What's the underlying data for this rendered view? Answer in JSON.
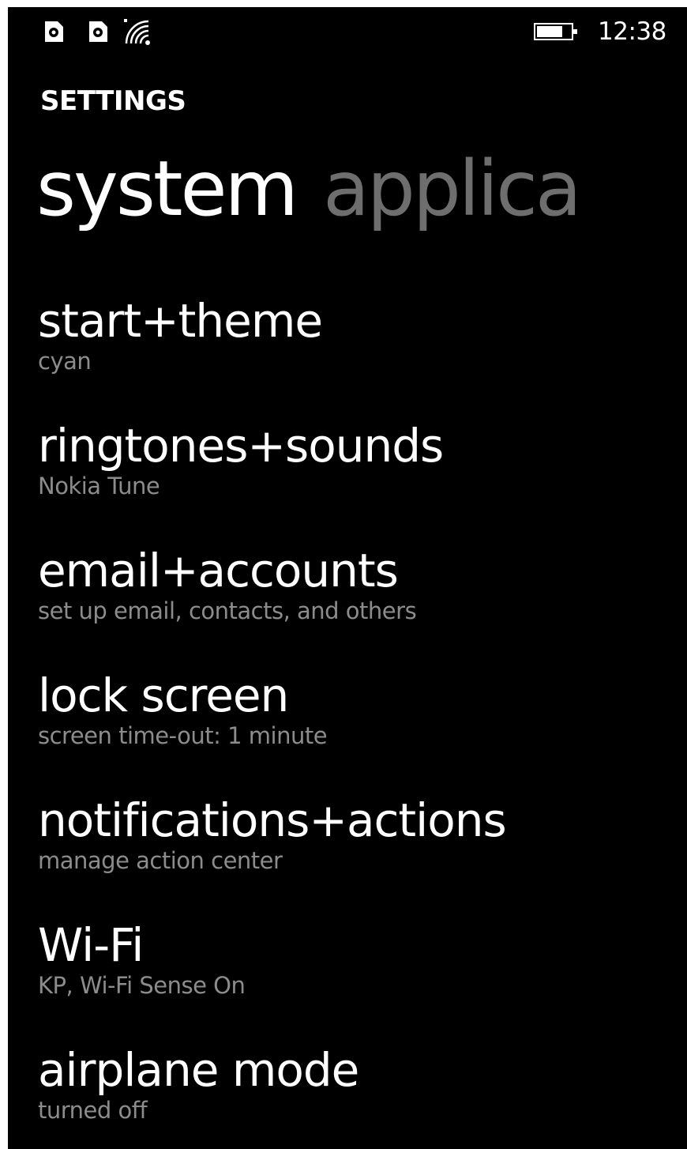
{
  "status_bar": {
    "icons": [
      "sim-1-icon",
      "sim-2-icon",
      "wifi-signal-icon",
      "battery-icon"
    ],
    "time": "12:38"
  },
  "app_title": "SETTINGS",
  "pivot": {
    "active": "system",
    "next": "applica"
  },
  "items": [
    {
      "title": "start+theme",
      "subtitle": "cyan"
    },
    {
      "title": "ringtones+sounds",
      "subtitle": "Nokia Tune"
    },
    {
      "title": "email+accounts",
      "subtitle": "set up email, contacts, and others"
    },
    {
      "title": "lock screen",
      "subtitle": "screen time-out: 1 minute"
    },
    {
      "title": "notifications+actions",
      "subtitle": "manage action center"
    },
    {
      "title": "Wi-Fi",
      "subtitle": "KP, Wi-Fi Sense On"
    },
    {
      "title": "airplane mode",
      "subtitle": "turned off"
    }
  ],
  "colors": {
    "background": "#000000",
    "foreground": "#ffffff",
    "subtle": "#8c8c8c",
    "pivot_inactive": "#6e6e6e"
  }
}
